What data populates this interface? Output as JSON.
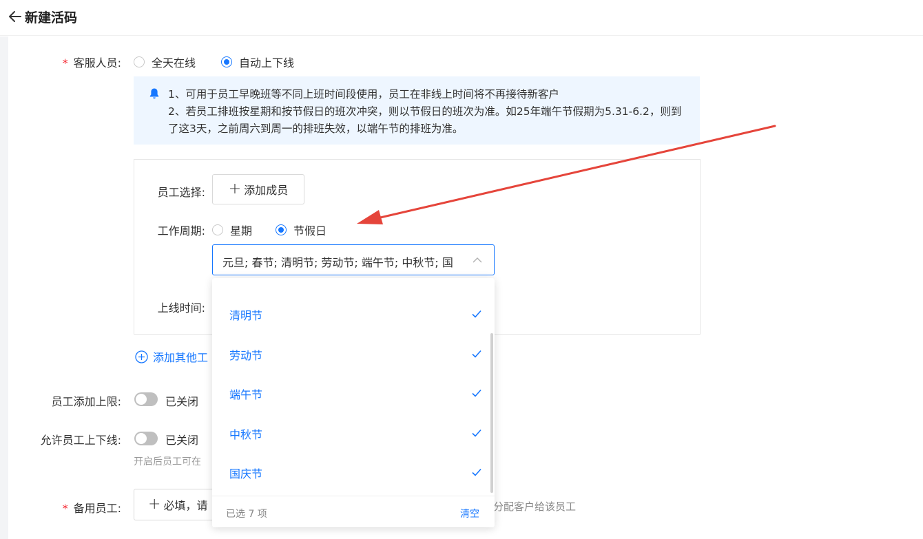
{
  "header": {
    "title": "新建活码"
  },
  "service_staff": {
    "label": "客服人员:",
    "options": [
      {
        "label": "全天在线",
        "selected": false
      },
      {
        "label": "自动上下线",
        "selected": true
      }
    ]
  },
  "notice": {
    "line1": "1、可用于员工早晚班等不同上班时间段使用，员工在非线上时间将不再接待新客户",
    "line2": "2、若员工排班按星期和按节假日的班次冲突，则以节假日的班次为准。如25年端午节假期为5.31-6.2，则到了这3天，之前周六到周一的排班失效，以端午节的排班为准。"
  },
  "panel": {
    "staff_select_label": "员工选择:",
    "add_member_label": "添加成员",
    "work_cycle_label": "工作周期:",
    "cycle_options": [
      {
        "label": "星期",
        "selected": false
      },
      {
        "label": "节假日",
        "selected": true
      }
    ],
    "holiday_select_value": "元旦; 春节; 清明节; 劳动节; 端午节; 中秋节; 国",
    "online_time_label": "上线时间:"
  },
  "add_other_label": "添加其他工",
  "staff_limit": {
    "label": "员工添加上限:",
    "state": "已关闭"
  },
  "allow_online": {
    "label": "允许员工上下线:",
    "state": "已关闭",
    "hint": "开启后员工可在"
  },
  "backup_staff": {
    "label": "备用员工:",
    "button_label": "必填，请",
    "hint": "分配客户给该员工"
  },
  "dropdown": {
    "items": [
      {
        "label": "清明节",
        "checked": true
      },
      {
        "label": "劳动节",
        "checked": true
      },
      {
        "label": "端午节",
        "checked": true
      },
      {
        "label": "中秋节",
        "checked": true
      },
      {
        "label": "国庆节",
        "checked": true
      }
    ],
    "selected_count": "已选 7 项",
    "clear_label": "清空"
  },
  "colors": {
    "primary": "#1677ff",
    "required": "#f5222d",
    "notice_bg": "#eef6ff",
    "annotation_arrow": "#e5453b"
  },
  "icons": [
    "back-arrow-icon",
    "bell-icon",
    "plus-icon",
    "chevron-up-icon",
    "check-icon",
    "plus-circle-icon"
  ]
}
